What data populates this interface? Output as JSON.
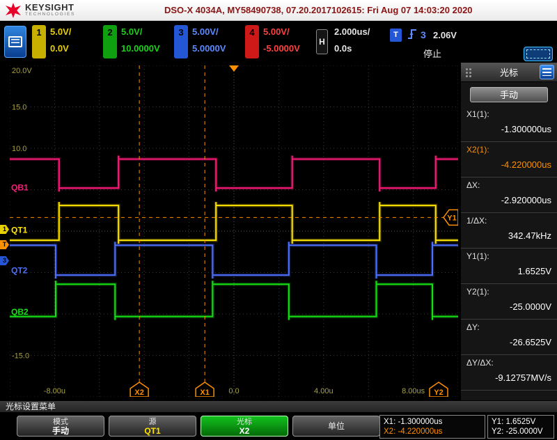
{
  "title_bar": {
    "brand": "KEYSIGHT",
    "brand_sub": "TECHNOLOGIES",
    "title": "DSO-X 4034A, MY58490738, 07.20.2017102615: Fri Aug 07 14:03:20 2020"
  },
  "ui_colors": {
    "accent": "#ff9000"
  },
  "channel_bar": {
    "channels": [
      {
        "num": "1",
        "scale": "5.0V/",
        "offset": "0.0V",
        "color": "#e8d000",
        "box": "#c7b000"
      },
      {
        "num": "2",
        "scale": "5.0V/",
        "offset": "10.0000V",
        "color": "#1ad01a",
        "box": "#0fa00f"
      },
      {
        "num": "3",
        "scale": "5.00V/",
        "offset": "5.0000V",
        "color": "#5c8aff",
        "box": "#2457d6"
      },
      {
        "num": "4",
        "scale": "5.00V/",
        "offset": "-5.0000V",
        "color": "#ff4040",
        "box": "#cf1818"
      }
    ],
    "timebase": {
      "label": "H",
      "scale": "2.000us/",
      "delay": "0.0s"
    },
    "trigger": {
      "label": "T",
      "source": "3",
      "level": "2.06V",
      "status": "停止"
    }
  },
  "scope": {
    "left_labels": [
      {
        "text": "20.0V",
        "v": 20
      },
      {
        "text": "15.0",
        "v": 15
      },
      {
        "text": "10.0",
        "v": 10
      },
      {
        "text": "-15.0",
        "v": -15
      }
    ],
    "bottom_labels": [
      {
        "text": "-8.00u",
        "us": -8
      },
      {
        "text": "0.0",
        "us": 0
      },
      {
        "text": "4.00u",
        "us": 4
      },
      {
        "text": "8.00us",
        "us": 8
      }
    ],
    "waves": [
      {
        "name": "QB1",
        "color": "#ff1a7a",
        "v_high": 8.7,
        "v_low": 5.2,
        "label_v": 4.9,
        "highs_us": [
          [
            -10,
            -7.8
          ],
          [
            -5.15,
            -0.8
          ],
          [
            2.6,
            6.5
          ],
          [
            9.0,
            10
          ]
        ]
      },
      {
        "name": "QT1",
        "color": "#ffe400",
        "v_high": 3.1,
        "v_low": -1.1,
        "label_v": -0.2,
        "highs_us": [
          [
            -7.8,
            -5.15
          ],
          [
            -0.8,
            2.6
          ],
          [
            6.5,
            9.0
          ]
        ]
      },
      {
        "name": "QT2",
        "color": "#4f6fff",
        "v_high": -1.7,
        "v_low": -5.3,
        "label_v": -5.1,
        "highs_us": [
          [
            -10,
            -7.95
          ],
          [
            -5.3,
            -0.95
          ],
          [
            2.45,
            6.35
          ],
          [
            8.85,
            10
          ]
        ]
      },
      {
        "name": "QB2",
        "color": "#16e016",
        "v_high": -6.4,
        "v_low": -10.3,
        "label_v": -10.1,
        "highs_us": [
          [
            -7.95,
            -5.3
          ],
          [
            -0.95,
            2.45
          ],
          [
            6.35,
            8.85
          ]
        ]
      }
    ],
    "cursors": {
      "x1_us": -1.3,
      "x2_us": -4.22,
      "y1_v": 1.6525,
      "color": "#ff9000",
      "flags": {
        "x1": "X1",
        "x2": "X2",
        "y1": "Y1",
        "y2": "Y2"
      }
    },
    "markers": [
      {
        "text": "1",
        "bg": "#e8d000"
      },
      {
        "text": "T",
        "bg": "#ff9000"
      },
      {
        "text": "3",
        "bg": "#2457d6"
      }
    ]
  },
  "right_panel": {
    "header": "光标",
    "mode_button": "手动",
    "rows": [
      {
        "label": "X1(1):",
        "value": "-1.300000us"
      },
      {
        "label": "X2(1):",
        "value": "-4.220000us"
      },
      {
        "label": "ΔX:",
        "value": "-2.920000us"
      },
      {
        "label": "1/ΔX:",
        "value": "342.47kHz"
      },
      {
        "label": "Y1(1):",
        "value": "1.6525V"
      },
      {
        "label": "Y2(1):",
        "value": "-25.0000V"
      },
      {
        "label": "ΔY:",
        "value": "-26.6525V"
      },
      {
        "label": "ΔY/ΔX:",
        "value": "-9.12757MV/s"
      }
    ]
  },
  "bottom_bar": {
    "menu_title": "光标设置菜单",
    "softkeys": [
      {
        "label": "模式",
        "value": "手动",
        "value_color": "#ffffff"
      },
      {
        "label": "源",
        "value": "QT1",
        "value_color": "#ffe400"
      },
      {
        "label": "光标",
        "value": "X2",
        "value_color": "#ffffff"
      },
      {
        "label": "单位",
        "value": "",
        "value_color": "#ffffff"
      }
    ],
    "readouts": [
      {
        "line1": "X1: -1.300000us",
        "line2": "X2: -4.220000us"
      },
      {
        "line1": "Y1: 1.6525V",
        "line2": "Y2: -25.0000V"
      }
    ]
  }
}
